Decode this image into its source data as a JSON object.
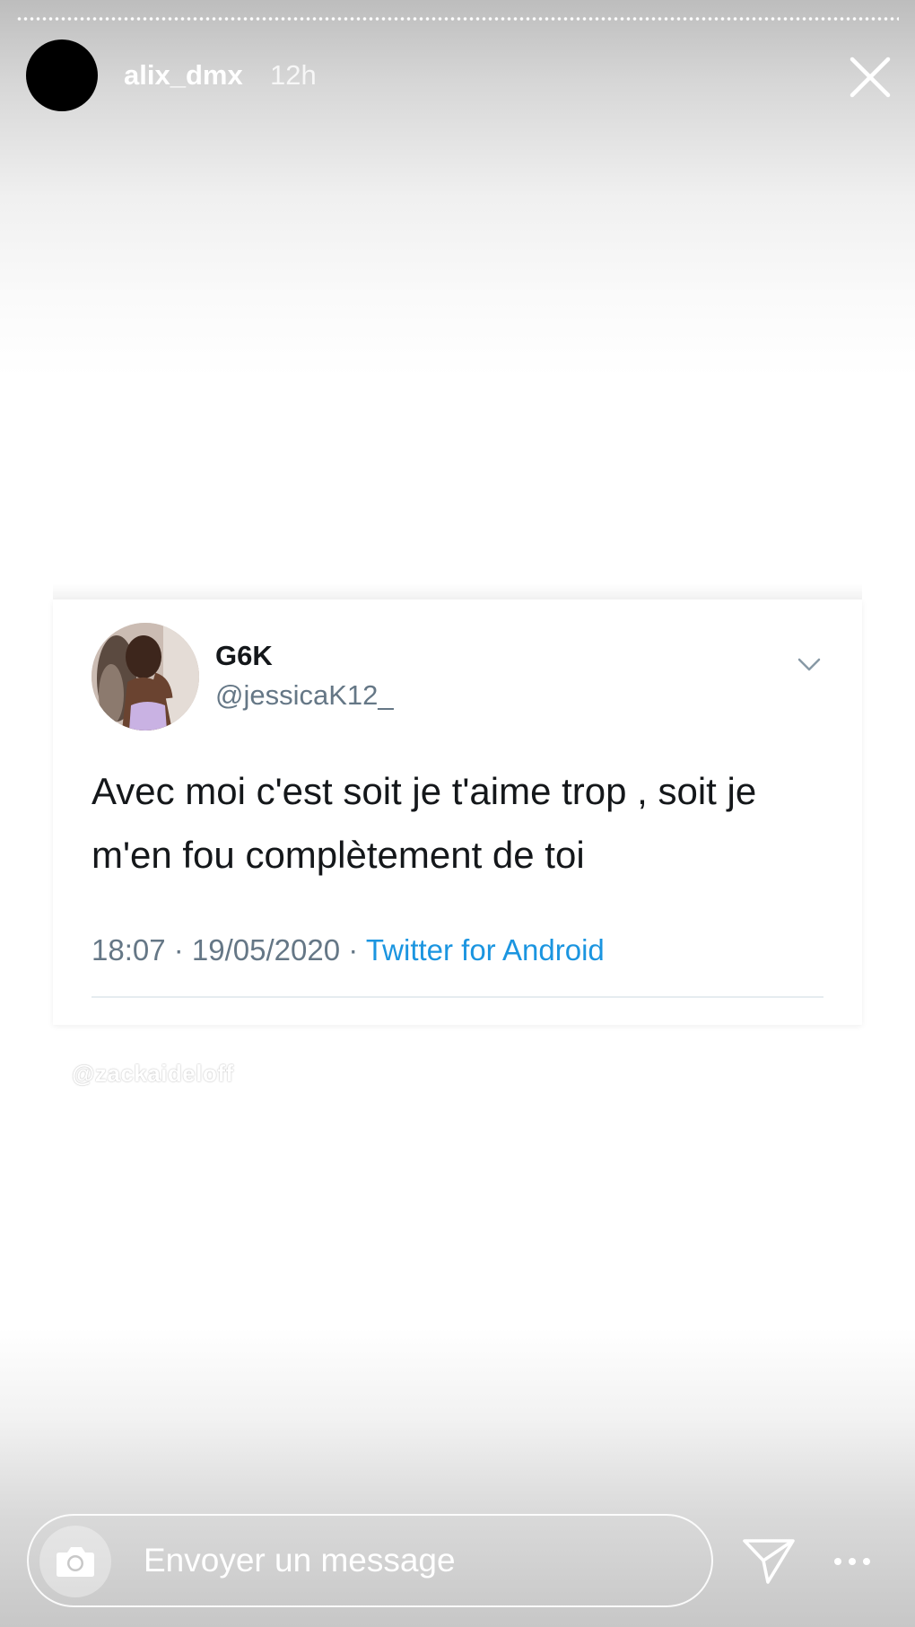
{
  "header": {
    "username": "alix_dmx",
    "time": "12h",
    "avatar_icon": "profile-avatar",
    "close_icon": "close-icon"
  },
  "tweet": {
    "name": "G6K",
    "handle": "@jessicaK12_",
    "text": "Avec moi c'est soit je t'aime trop , soit je m'en fou complètement de toi",
    "meta": "18:07 · 19/05/2020 · ",
    "source": "Twitter for Android",
    "menu_icon": "chevron-down-icon"
  },
  "watermark": "@zackaideloff",
  "footer": {
    "placeholder": "Envoyer un message",
    "camera_icon": "camera-icon",
    "send_icon": "send-icon",
    "more_icon": "more-icon"
  },
  "colors": {
    "tweet_text": "#14171a",
    "tweet_secondary": "#657786",
    "link": "#1b95e0"
  }
}
